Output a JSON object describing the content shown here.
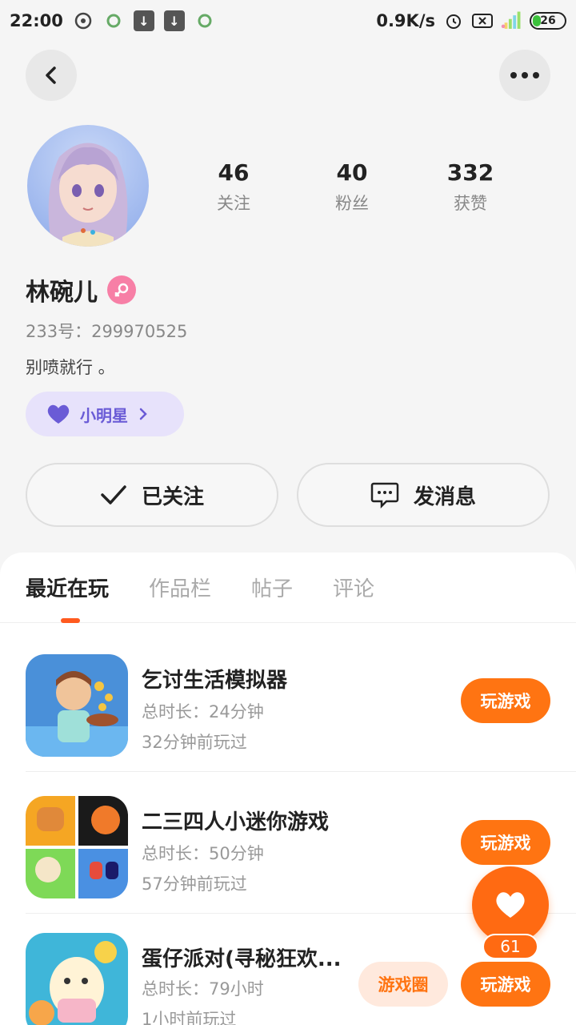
{
  "status_bar": {
    "time": "22:00",
    "network_speed": "0.9K/s",
    "battery": "26"
  },
  "profile": {
    "stats": [
      {
        "value": "46",
        "label": "关注"
      },
      {
        "value": "40",
        "label": "粉丝"
      },
      {
        "value": "332",
        "label": "获赞"
      }
    ],
    "name": "林碗儿",
    "uid": "233号：299970525",
    "bio": "别喷就行 。",
    "badge_label": "小明星"
  },
  "actions": {
    "follow_label": "已关注",
    "message_label": "发消息"
  },
  "tabs": [
    "最近在玩",
    "作品栏",
    "帖子",
    "评论"
  ],
  "games": [
    {
      "title": "乞讨生活模拟器",
      "duration": "总时长：24分钟",
      "last_played": "32分钟前玩过",
      "play_label": "玩游戏"
    },
    {
      "title": "二三四人小迷你游戏",
      "duration": "总时长：50分钟",
      "last_played": "57分钟前玩过",
      "play_label": "玩游戏"
    },
    {
      "title": "蛋仔派对(寻秘狂欢...",
      "duration": "总时长：79小时",
      "last_played": "1小时前玩过",
      "play_label": "玩游戏",
      "circle_label": "游戏圈"
    }
  ],
  "fab": {
    "count": "61"
  },
  "colors": {
    "accent": "#ff7412",
    "badge": "#6a5bd6",
    "gender": "#f77fa6"
  }
}
